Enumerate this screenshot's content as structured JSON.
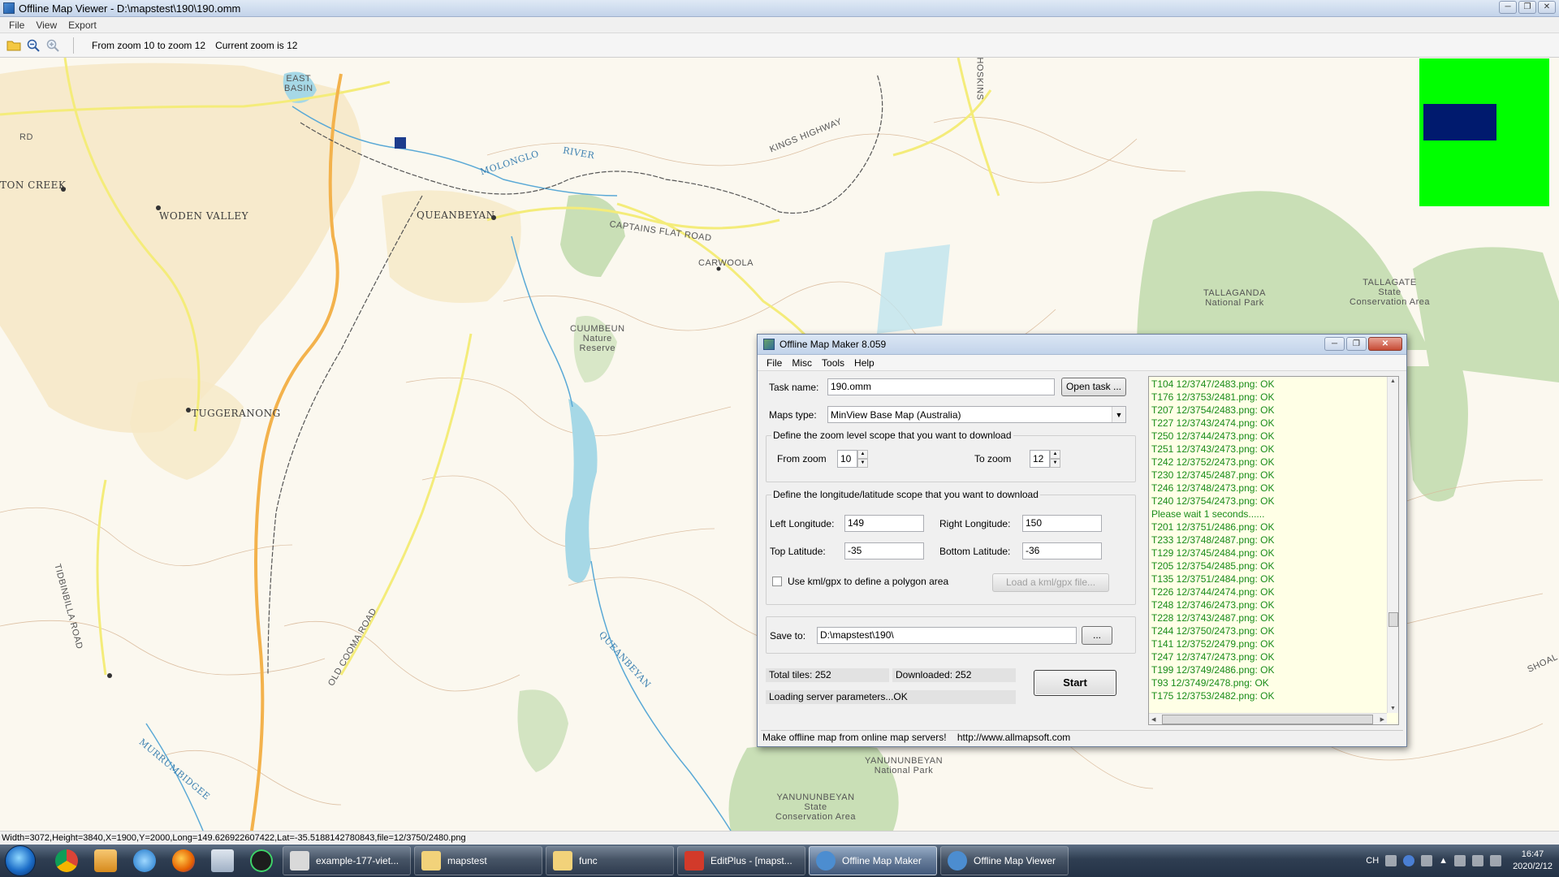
{
  "window": {
    "title": "Offline Map Viewer - D:\\mapstest\\190\\190.omm",
    "menu": [
      "File",
      "View",
      "Export"
    ],
    "toolbar": {
      "zoom_range_text": "From zoom 10 to zoom 12",
      "current_zoom_text": "Current zoom is 12"
    },
    "status": "Width=3072,Height=3840,X=1900,Y=2000,Long=149.626922607422,Lat=-35.5188142780843,file=12/3750/2480.png"
  },
  "map": {
    "labels": {
      "woden": "WODEN VALLEY",
      "weston": "TON CREEK",
      "queanbeyan": "QUEANBEYAN",
      "tuggeranong": "TUGGERANONG",
      "molonglo": "MOLONGLO",
      "river": "RIVER",
      "kings_hwy": "KINGS HIGHWAY",
      "captains_flat": "CAPTAINS   FLAT   ROAD",
      "carwoola": "CARWOOLA",
      "cuumbeun": "CUUMBEUN\nNature\nReserve",
      "tallaganda_np": "TALLAGANDA\nNational Park",
      "tallaganda_sca": "TALLAGATE\nState\nConservation Area",
      "yanunbeyan_np": "YANUNUNBEYAN\nNational Park",
      "yanunbeyan_sca": "YANUNUNBEYAN\nState\nConservation Area",
      "queanbeyan_river": "QUEANBEYAN",
      "east_basin": "EAST\nBASIN",
      "old_cooma_rd": "OLD   COOMA   ROAD",
      "tidbinbilla_rd": "TIDBINBILLA   ROAD",
      "murrumbidgee": "MURRUMBIDGEE",
      "shoalhaven": "SHOAL",
      "hoskins": "HOSKINS",
      "rd": "RD"
    },
    "colors": {
      "urban": "#f6e8c6",
      "park": "#c9dfb6",
      "water": "#a6d8e6",
      "highway": "#f3b24c",
      "road": "#f4ec7a",
      "contour": "#d9b99a"
    }
  },
  "dialog": {
    "title": "Offline Map Maker 8.059",
    "menu": [
      "File",
      "Misc",
      "Tools",
      "Help"
    ],
    "task_name_label": "Task name:",
    "task_name_value": "190.omm",
    "open_task_label": "Open task ...",
    "maps_type_label": "Maps type:",
    "maps_type_value": "MinView Base Map (Australia)",
    "zoom_group_label": "Define the zoom level scope that you want to download",
    "from_zoom_label": "From zoom",
    "from_zoom_value": "10",
    "to_zoom_label": "To zoom",
    "to_zoom_value": "12",
    "lonlat_group_label": "Define the longitude/latitude scope that you want to download",
    "left_lon_label": "Left Longitude:",
    "left_lon_value": "149",
    "right_lon_label": "Right Longitude:",
    "right_lon_value": "150",
    "top_lat_label": "Top Latitude:",
    "top_lat_value": "-35",
    "bottom_lat_label": "Bottom Latitude:",
    "bottom_lat_value": "-36",
    "kml_checkbox_label": "Use kml/gpx to define a polygon area",
    "load_kml_label": "Load a kml/gpx file...",
    "save_to_label": "Save to:",
    "save_to_value": "D:\\mapstest\\190\\",
    "browse_label": "...",
    "total_tiles": "Total tiles: 252",
    "downloaded": "Downloaded: 252",
    "loading_status": "Loading server parameters...OK",
    "start_label": "Start",
    "footer": "Make offline map from online map servers!    http://www.allmapsoft.com",
    "log": [
      "T104 12/3747/2483.png: OK",
      "T176 12/3753/2481.png: OK",
      "T207 12/3754/2483.png: OK",
      "T227 12/3743/2474.png: OK",
      "T250 12/3744/2473.png: OK",
      "T251 12/3743/2473.png: OK",
      "T242 12/3752/2473.png: OK",
      "T230 12/3745/2487.png: OK",
      "T246 12/3748/2473.png: OK",
      "T240 12/3754/2473.png: OK",
      "Please wait 1 seconds......",
      "T201 12/3751/2486.png: OK",
      "T233 12/3748/2487.png: OK",
      "T129 12/3745/2484.png: OK",
      "T205 12/3754/2485.png: OK",
      "T135 12/3751/2484.png: OK",
      "T226 12/3744/2474.png: OK",
      "T248 12/3746/2473.png: OK",
      "T228 12/3743/2487.png: OK",
      "T244 12/3750/2473.png: OK",
      "T141 12/3752/2479.png: OK",
      "T247 12/3747/2473.png: OK",
      "T199 12/3749/2486.png: OK",
      "T93 12/3749/2478.png: OK",
      "T175 12/3753/2482.png: OK"
    ]
  },
  "taskbar": {
    "tasks": [
      {
        "label": "example-177-viet...",
        "icon_color": "#d9d9d9"
      },
      {
        "label": "mapstest",
        "icon_color": "#f2d27a"
      },
      {
        "label": "func",
        "icon_color": "#f2d27a"
      },
      {
        "label": "EditPlus - [mapst...",
        "icon_color": "#d23a2a"
      },
      {
        "label": "Offline Map Maker",
        "icon_color": "#4c8dd0"
      },
      {
        "label": "Offline Map Viewer",
        "icon_color": "#4c8dd0"
      }
    ],
    "tray_lang": "CH",
    "clock_time": "16:47",
    "clock_date": "2020/2/12"
  }
}
